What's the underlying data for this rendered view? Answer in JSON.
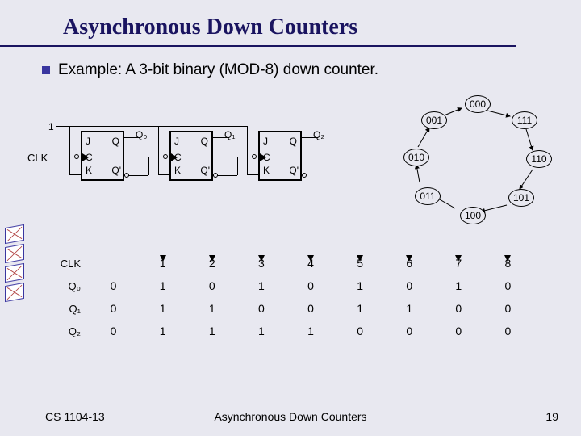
{
  "title": "Asynchronous Down Counters",
  "bullet": "Example: A 3-bit binary (MOD-8) down counter.",
  "circuit": {
    "input_high": "1",
    "clk_label": "CLK",
    "ff_labels": {
      "J": "J",
      "K": "K",
      "C": "C",
      "Q": "Q",
      "Qp": "Q'"
    },
    "outputs": [
      "Q₀",
      "Q₁",
      "Q₂"
    ]
  },
  "states": [
    "000",
    "111",
    "110",
    "101",
    "100",
    "011",
    "010",
    "001"
  ],
  "timing": {
    "clk_label": "CLK",
    "clk_ticks": [
      "1",
      "2",
      "3",
      "4",
      "5",
      "6",
      "7",
      "8"
    ],
    "rows": [
      {
        "label": "Q₀",
        "values": [
          "0",
          "1",
          "0",
          "1",
          "0",
          "1",
          "0",
          "1",
          "0"
        ]
      },
      {
        "label": "Q₁",
        "values": [
          "0",
          "1",
          "1",
          "0",
          "0",
          "1",
          "1",
          "0",
          "0"
        ]
      },
      {
        "label": "Q₂",
        "values": [
          "0",
          "1",
          "1",
          "1",
          "1",
          "0",
          "0",
          "0",
          "0"
        ]
      }
    ]
  },
  "footer": {
    "left": "CS 1104-13",
    "center": "Asynchronous Down Counters",
    "right": "19"
  }
}
